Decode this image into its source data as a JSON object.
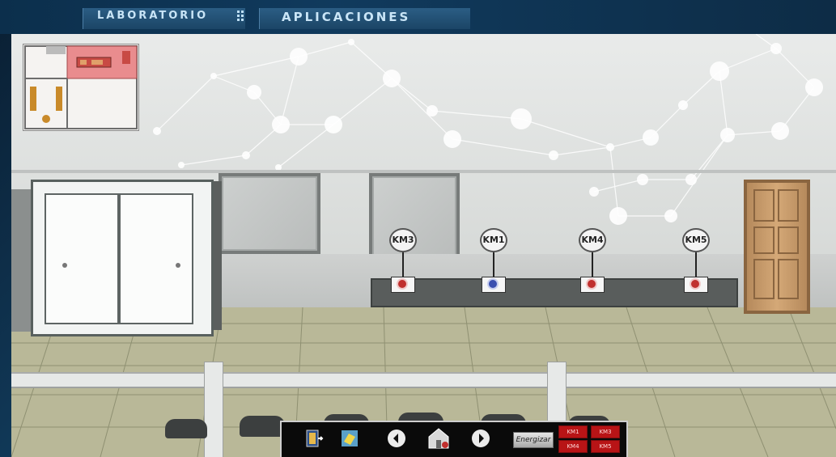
{
  "header": {
    "lab_label": "LABORATORIO",
    "apps_label": "APLICACIONES"
  },
  "contactors": [
    {
      "label": "KM3",
      "indicator": "#c0302e"
    },
    {
      "label": "KM1",
      "indicator": "#3a4fb0"
    },
    {
      "label": "KM4",
      "indicator": "#c0302e"
    },
    {
      "label": "KM5",
      "indicator": "#c0302e"
    }
  ],
  "toolbar": {
    "energize_label": "Energizar",
    "km_buttons": [
      "KM1",
      "KM3",
      "KM4",
      "KM5"
    ],
    "icons": [
      "exit-icon",
      "notes-icon",
      "arrow-left-icon",
      "home-icon",
      "arrow-right-icon"
    ]
  },
  "colors": {
    "frame": "#0c2a44",
    "km_button": "#b81416",
    "indicator_on": "#3a4fb0",
    "indicator_off": "#c0302e"
  }
}
